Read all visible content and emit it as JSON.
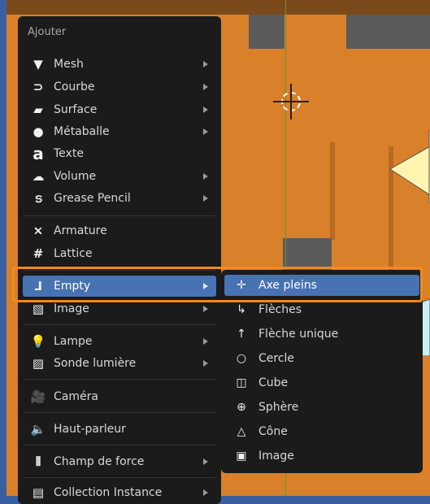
{
  "menu": {
    "title": "Ajouter",
    "items": [
      {
        "label": "Mesh",
        "icon": "mesh-icon",
        "has_submenu": true
      },
      {
        "label": "Courbe",
        "icon": "curve-icon",
        "has_submenu": true
      },
      {
        "label": "Surface",
        "icon": "surface-icon",
        "has_submenu": true
      },
      {
        "label": "Métaballe",
        "icon": "metaball-icon",
        "has_submenu": true
      },
      {
        "label": "Texte",
        "icon": "text-icon",
        "has_submenu": false
      },
      {
        "label": "Volume",
        "icon": "volume-icon",
        "has_submenu": true
      },
      {
        "label": "Grease Pencil",
        "icon": "grease-pencil-icon",
        "has_submenu": true
      },
      {
        "label": "Armature",
        "icon": "armature-icon",
        "has_submenu": false
      },
      {
        "label": "Lattice",
        "icon": "lattice-icon",
        "has_submenu": false
      },
      {
        "label": "Empty",
        "icon": "empty-icon",
        "has_submenu": true,
        "active": true
      },
      {
        "label": "Image",
        "icon": "image-icon",
        "has_submenu": true
      },
      {
        "label": "Lampe",
        "icon": "light-icon",
        "has_submenu": true
      },
      {
        "label": "Sonde lumière",
        "icon": "light-probe-icon",
        "has_submenu": true
      },
      {
        "label": "Caméra",
        "icon": "camera-icon",
        "has_submenu": false
      },
      {
        "label": "Haut-parleur",
        "icon": "speaker-icon",
        "has_submenu": false
      },
      {
        "label": "Champ de force",
        "icon": "force-field-icon",
        "has_submenu": true
      },
      {
        "label": "Collection Instance",
        "icon": "collection-instance-icon",
        "has_submenu": true
      }
    ]
  },
  "submenu": {
    "items": [
      {
        "label": "Axe pleins",
        "icon": "plain-axes-icon",
        "active": true
      },
      {
        "label": "Flèches",
        "icon": "arrows-icon"
      },
      {
        "label": "Flèche unique",
        "icon": "single-arrow-icon"
      },
      {
        "label": "Cercle",
        "icon": "circle-icon"
      },
      {
        "label": "Cube",
        "icon": "cube-icon"
      },
      {
        "label": "Sphère",
        "icon": "sphere-icon"
      },
      {
        "label": "Cône",
        "icon": "cone-icon"
      },
      {
        "label": "Image",
        "icon": "image-icon"
      }
    ]
  },
  "colors": {
    "highlight": "#4772b3",
    "annotation_border": "#f28a1a",
    "viewport": "#d9802b"
  }
}
